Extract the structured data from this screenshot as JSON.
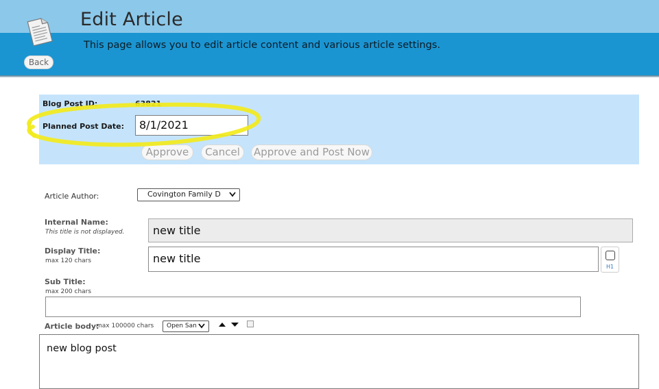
{
  "header": {
    "title": "Edit Article",
    "description": "This page allows you to edit article content and various article settings.",
    "back_label": "Back",
    "icon": "document-icon"
  },
  "post_panel": {
    "id_label": "Blog Post ID:",
    "id_value": "63821",
    "date_label": "Planned Post Date:",
    "date_value": "8/1/2021",
    "approve_label": "Approve",
    "cancel_label": "Cancel",
    "approve_post_label": "Approve and Post Now",
    "highlight_color": "#f2ea1c"
  },
  "form": {
    "author_label": "Article Author:",
    "author_value": "Covington Family D",
    "internal_name_label": "Internal Name:",
    "internal_name_hint": "This title is not displayed.",
    "internal_name_value": "new title",
    "display_title_label": "Display Title:",
    "display_title_hint": "max 120 chars",
    "display_title_value": "new title",
    "h1_label": "H1",
    "subtitle_label": "Sub Title:",
    "subtitle_hint": "max 200 chars",
    "subtitle_value": "",
    "body_label": "Article body:",
    "body_hint": "max 100000 chars",
    "font_value": "Open San",
    "body_value": "new blog post"
  },
  "colors": {
    "header_light": "#8cc8ea",
    "header_dark": "#1b95d2",
    "panel_bg": "#c5e4fb"
  }
}
